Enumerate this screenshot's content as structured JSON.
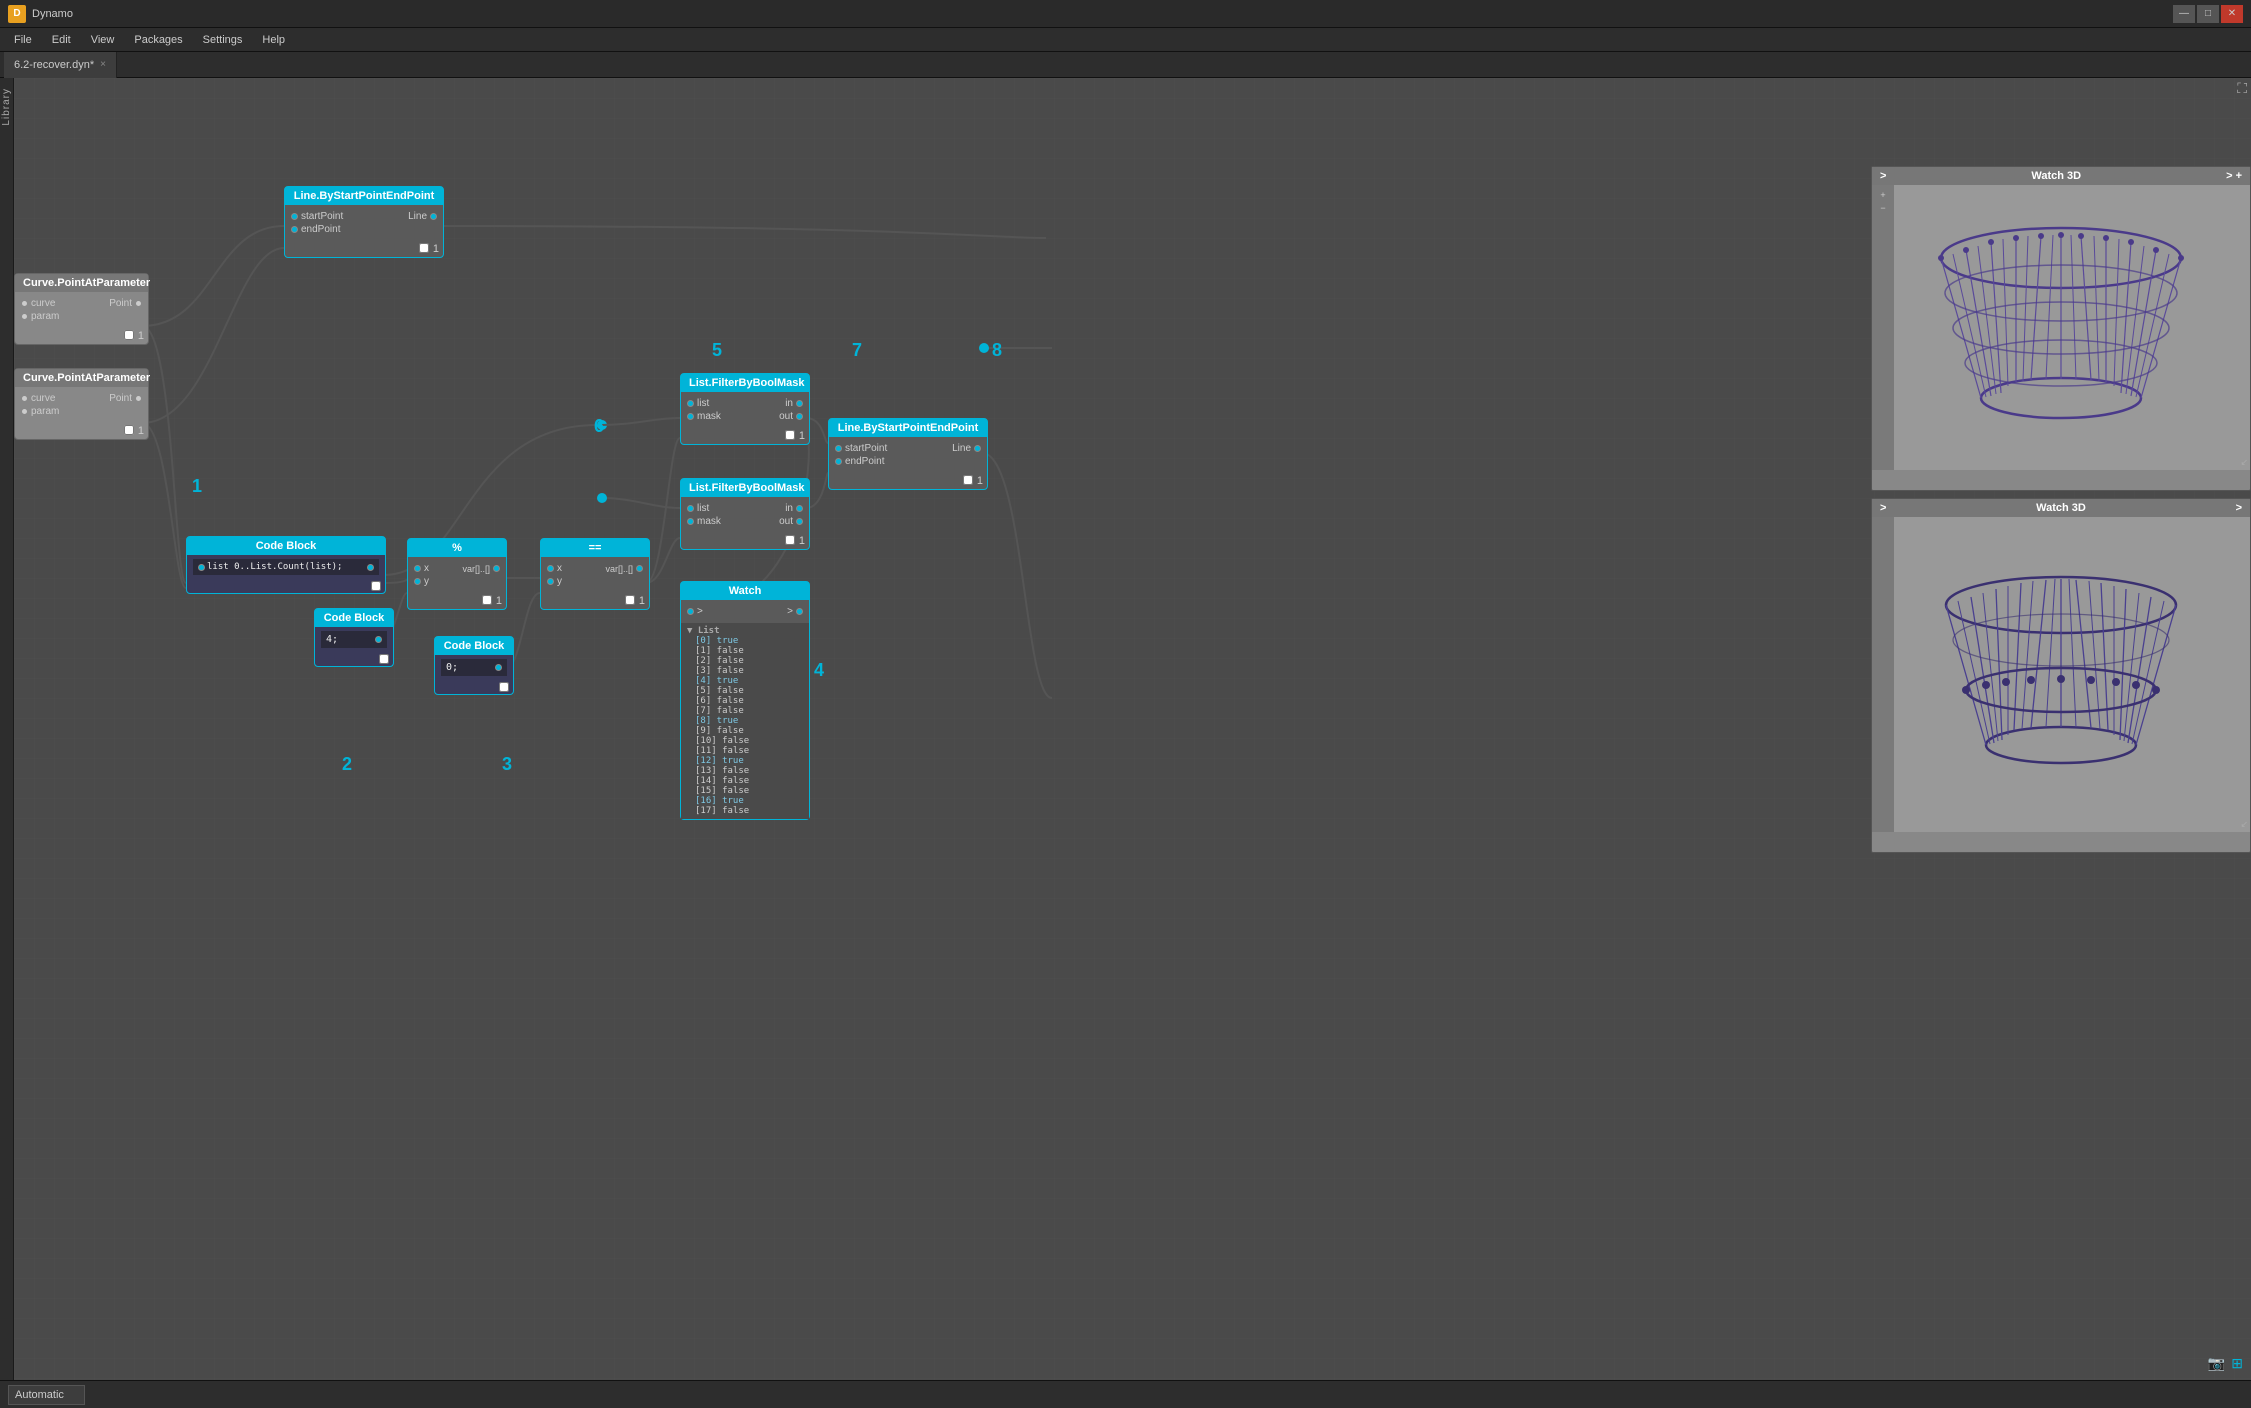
{
  "app": {
    "title": "Dynamo",
    "icon_label": "D"
  },
  "title_bar": {
    "text": "Dynamo",
    "min_btn": "—",
    "max_btn": "□",
    "close_btn": "✕"
  },
  "menu": {
    "items": [
      "File",
      "Edit",
      "View",
      "Packages",
      "Settings",
      "Help"
    ]
  },
  "tab": {
    "name": "6.2-recover.dyn*",
    "close": "×"
  },
  "canvas": {
    "background_note": "grid pattern"
  },
  "nodes": {
    "line1": {
      "header": "Line.ByStartPointEndPoint",
      "ports_left": [
        "startPoint",
        "endPoint"
      ],
      "ports_right": [
        "Line"
      ]
    },
    "curve1": {
      "header": "Curve.PointAtParameter",
      "ports_left": [
        "curve",
        "param"
      ],
      "ports_right": [
        "Point"
      ]
    },
    "curve2": {
      "header": "Curve.PointAtParameter",
      "ports_left": [
        "curve",
        "param"
      ],
      "ports_right": [
        "Point"
      ]
    },
    "codeblock1": {
      "header": "Code Block",
      "code": "list 0..List.Count(list);"
    },
    "codeblock2": {
      "header": "Code Block",
      "code": "4;"
    },
    "modulo": {
      "header": "%",
      "ports_left": [
        "x",
        "y"
      ],
      "ports_right": [
        "var[]..[]"
      ]
    },
    "codeblock3": {
      "header": "Code Block",
      "code": "0;"
    },
    "equals": {
      "header": "==",
      "ports_left": [
        "x",
        "y"
      ],
      "ports_right": [
        "var[]..[]"
      ]
    },
    "filter1": {
      "header": "List.FilterByBoolMask",
      "ports_left": [
        "list",
        "mask"
      ],
      "ports_right": [
        "in",
        "out"
      ]
    },
    "filter2": {
      "header": "List.FilterByBoolMask",
      "ports_left": [
        "list",
        "mask"
      ],
      "ports_right": [
        "in",
        "out"
      ]
    },
    "watch": {
      "header": "Watch",
      "list_header": "List",
      "items": [
        {
          "index": "[0]",
          "value": "true",
          "is_true": true
        },
        {
          "index": "[1]",
          "value": "false",
          "is_true": false
        },
        {
          "index": "[2]",
          "value": "false",
          "is_true": false
        },
        {
          "index": "[3]",
          "value": "false",
          "is_true": false
        },
        {
          "index": "[4]",
          "value": "true",
          "is_true": true
        },
        {
          "index": "[5]",
          "value": "false",
          "is_true": false
        },
        {
          "index": "[6]",
          "value": "false",
          "is_true": false
        },
        {
          "index": "[7]",
          "value": "false",
          "is_true": false
        },
        {
          "index": "[8]",
          "value": "true",
          "is_true": true
        },
        {
          "index": "[9]",
          "value": "false",
          "is_true": false
        },
        {
          "index": "[10]",
          "value": "false",
          "is_true": false
        },
        {
          "index": "[11]",
          "value": "false",
          "is_true": false
        },
        {
          "index": "[12]",
          "value": "true",
          "is_true": true
        },
        {
          "index": "[13]",
          "value": "false",
          "is_true": false
        },
        {
          "index": "[14]",
          "value": "false",
          "is_true": false
        },
        {
          "index": "[15]",
          "value": "false",
          "is_true": false
        },
        {
          "index": "[16]",
          "value": "true",
          "is_true": true
        },
        {
          "index": "[17]",
          "value": "false",
          "is_true": false
        }
      ]
    },
    "line2": {
      "header": "Line.ByStartPointEndPoint",
      "ports_left": [
        "startPoint",
        "endPoint"
      ],
      "ports_right": [
        "Line"
      ]
    },
    "watch3d_top": {
      "header": "Watch 3D"
    },
    "watch3d_bottom": {
      "header": "Watch 3D"
    }
  },
  "labels": {
    "one": "1",
    "two": "2",
    "three": "3",
    "four": "4",
    "five": "5",
    "six": "6",
    "seven": "7",
    "eight": "8"
  },
  "status_bar": {
    "dropdown_value": "Automatic",
    "dropdown_arrow": "▼"
  }
}
